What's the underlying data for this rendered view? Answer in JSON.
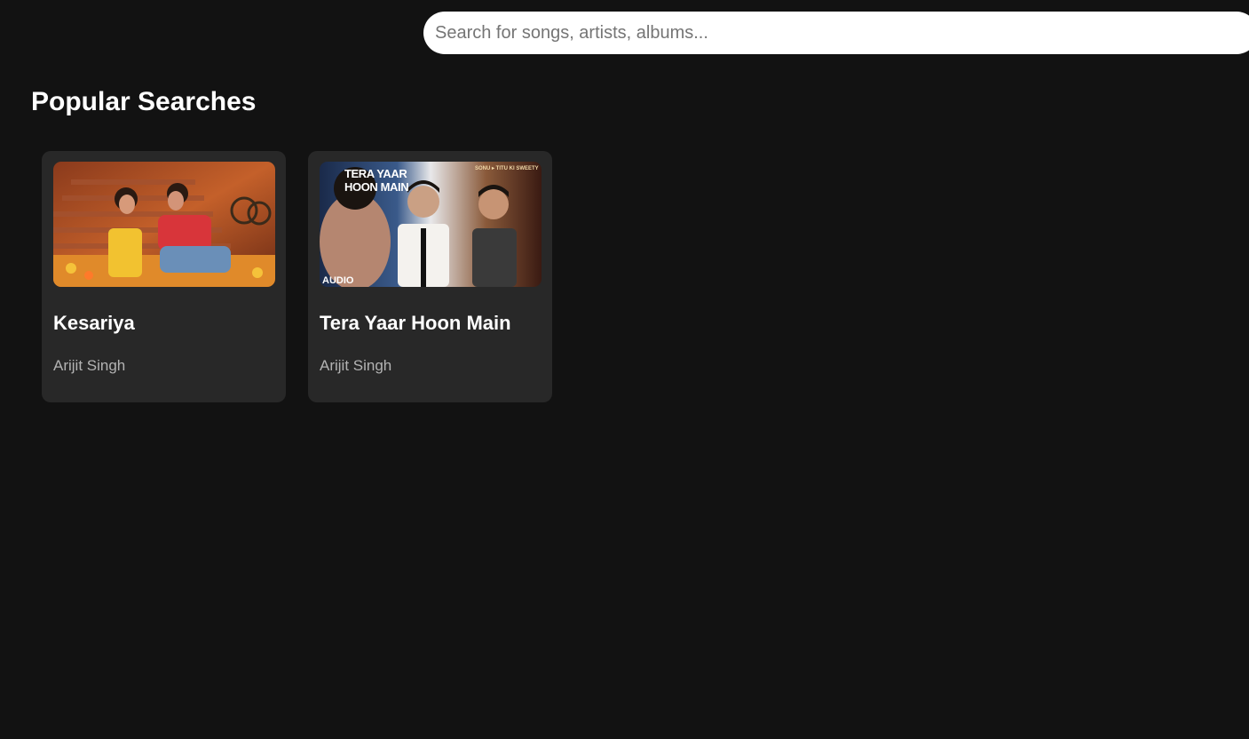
{
  "search": {
    "placeholder": "Search for songs, artists, albums..."
  },
  "section": {
    "title": "Popular Searches"
  },
  "cards": [
    {
      "title": "Kesariya",
      "artist": "Arijit Singh"
    },
    {
      "title": "Tera Yaar Hoon Main",
      "artist": "Arijit Singh",
      "thumb_text": {
        "headline": "TERA YAAR HOON MAIN",
        "corner": "SONU ▸ TITU KI SWEETY",
        "badge": "AUDIO"
      }
    }
  ],
  "colors": {
    "background": "#121212",
    "card": "#282828",
    "secondary_text": "#b3b3b3"
  }
}
